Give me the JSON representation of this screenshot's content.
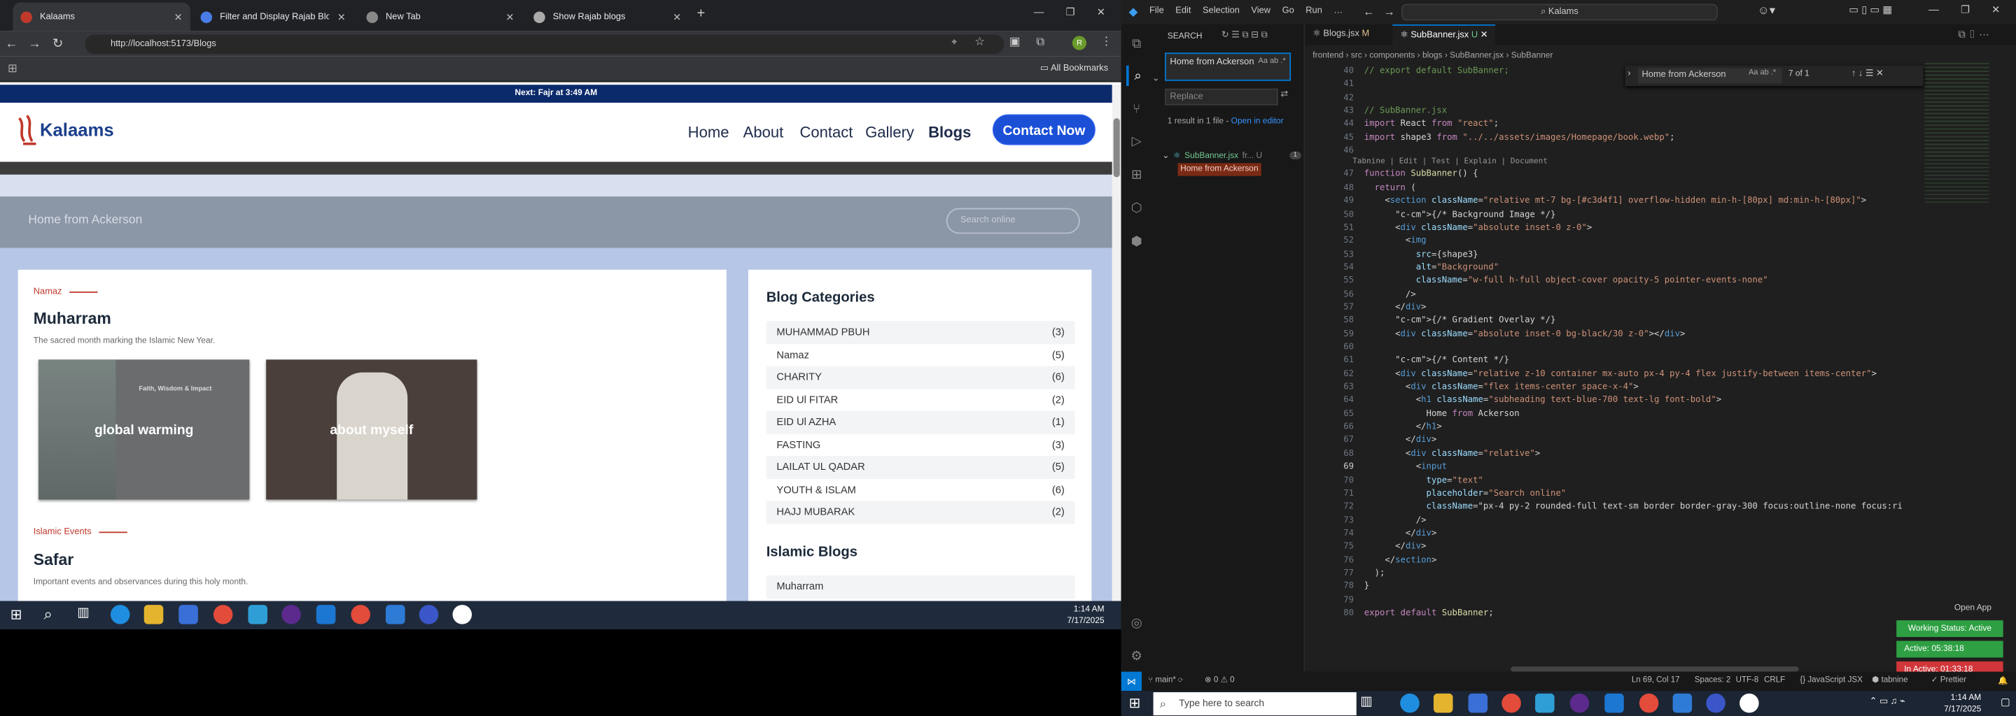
{
  "browser": {
    "tabs": [
      {
        "title": "Kalaams",
        "active": true
      },
      {
        "title": "Filter and Display Rajab Blog In"
      },
      {
        "title": "New Tab"
      },
      {
        "title": "Show Rajab blogs"
      }
    ],
    "url": "http://localhost:5173/Blogs",
    "bookmarks_label": "All Bookmarks",
    "profile_initial": "R"
  },
  "site": {
    "announcement": "Next: Fajr at 3:49 AM",
    "logo_text": "Kalaams",
    "nav": [
      "Home",
      "About",
      "Contact",
      "Gallery",
      "Blogs"
    ],
    "cta": "Contact Now",
    "banner_title": "Home from Ackerson",
    "search_placeholder": "Search online",
    "posts": [
      {
        "category": "Namaz",
        "title": "Muharram",
        "desc": "The sacred month marking the Islamic New Year.",
        "cards": [
          {
            "label": "global warming",
            "inner_title": "Faith, Wisdom & Impact"
          },
          {
            "label": "about myself"
          }
        ]
      },
      {
        "category": "Islamic Events",
        "title": "Safar",
        "desc": "Important events and observances during this holy month."
      }
    ],
    "sidebar_title": "Blog Categories",
    "categories": [
      {
        "name": "MUHAMMAD PBUH",
        "count": "(3)"
      },
      {
        "name": "Namaz",
        "count": "(5)"
      },
      {
        "name": "CHARITY",
        "count": "(6)"
      },
      {
        "name": "EID Ul FITAR",
        "count": "(2)"
      },
      {
        "name": "EID Ul AZHA",
        "count": "(1)"
      },
      {
        "name": "FASTING",
        "count": "(3)"
      },
      {
        "name": "LAILAT UL QADAR",
        "count": "(5)"
      },
      {
        "name": "YOUTH & ISLAM",
        "count": "(6)"
      },
      {
        "name": "HAJJ MUBARAK",
        "count": "(2)"
      }
    ],
    "islamic_blogs_title": "Islamic Blogs",
    "islamic_blogs_first": "Muharram"
  },
  "inner_clock": {
    "time": "1:14 AM",
    "date": "7/17/2025"
  },
  "vscode": {
    "menu": [
      "File",
      "Edit",
      "Selection",
      "View",
      "Go",
      "Run",
      "…"
    ],
    "search_box": "Kalams",
    "sidebar_title": "SEARCH",
    "search_value": "Home from Ackerson",
    "replace_placeholder": "Replace",
    "result_summary": "1 result in 1 file - ",
    "open_in_editor": "Open in editor",
    "result_file": "SubBanner.jsx",
    "result_file_path": "fr... U",
    "result_badge": "1",
    "result_match": "Home from Ackerson",
    "tabs": [
      {
        "title": "Blogs.jsx",
        "flag": "M"
      },
      {
        "title": "SubBanner.jsx",
        "flag": "U",
        "active": true
      }
    ],
    "breadcrumb": [
      "frontend",
      "src",
      "components",
      "blogs",
      "SubBanner.jsx",
      "SubBanner"
    ],
    "find_widget": {
      "value": "Home from Ackerson",
      "count": "7 of 1"
    },
    "codelens": "Tabnine | Edit | Test | Explain | Document",
    "line_start": 40,
    "lines": [
      "// export default SubBanner;",
      "",
      "",
      "// SubBanner.jsx",
      "import React from \"react\";",
      "import shape3 from \"../../assets/images/Homepage/book.webp\";",
      "",
      "function SubBanner() {",
      "  return (",
      "    <section className=\"relative mt-7 bg-[#c3d4f1] overflow-hidden min-h-[80px] md:min-h-[80px]\">",
      "      {/* Background Image */}",
      "      <div className=\"absolute inset-0 z-0\">",
      "        <img",
      "          src={shape3}",
      "          alt=\"Background\"",
      "          className=\"w-full h-full object-cover opacity-5 pointer-events-none\"",
      "        />",
      "      </div>",
      "      {/* Gradient Overlay */}",
      "      <div className=\"absolute inset-0 bg-black/30 z-0\"></div>",
      "",
      "      {/* Content */}",
      "      <div className=\"relative z-10 container mx-auto px-4 py-4 flex justify-between items-center\">",
      "        <div className=\"flex items-center space-x-4\">",
      "          <h1 className=\"subheading text-blue-700 text-lg font-bold\">",
      "            Home from Ackerson",
      "          </h1>",
      "        </div>",
      "        <div className=\"relative\">",
      "          <input",
      "            type=\"text\"",
      "            placeholder=\"Search online\"",
      "            className=\"px-4 py-2 rounded-full text-sm border border-gray-300 focus:outline-none focus:ri",
      "          />",
      "        </div>",
      "      </div>",
      "    </section>",
      "  );",
      "}",
      "",
      "export default SubBanner;"
    ],
    "status": {
      "branch": "main*",
      "problems": "0 ⚠ 0",
      "position": "Ln 69, Col 17",
      "spaces": "Spaces: 2",
      "encoding": "UTF-8",
      "eol": "CRLF",
      "language": "JavaScript JSX",
      "tabnine": "tabnine",
      "prettier": "Prettier"
    },
    "open_app": "Open App",
    "wakatime": {
      "working": "Working Status: Active",
      "active": "Active: 05:38:18",
      "inactive": "In Active: 01:33:18"
    }
  },
  "taskbar": {
    "search_placeholder": "Type here to search",
    "time": "1:14 AM",
    "date": "7/17/2025"
  }
}
